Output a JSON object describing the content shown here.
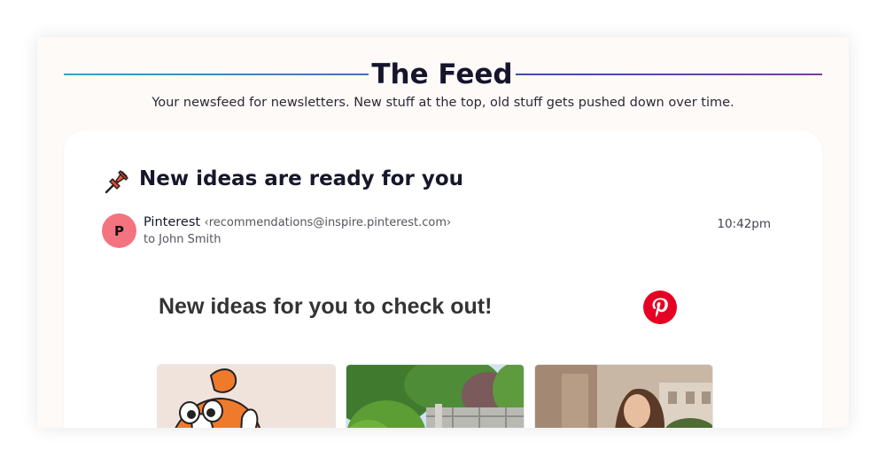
{
  "feed": {
    "title": "The Feed",
    "subtitle": "Your newsfeed for newsletters. New stuff at the top, old stuff gets pushed down over time."
  },
  "email": {
    "subject": "New ideas are ready for you",
    "subject_icon": "pushpin-icon",
    "sender": {
      "avatar_letter": "P",
      "avatar_color": "#f47380",
      "name": "Pinterest",
      "email": "‹recommendations@inspire.pinterest.com›",
      "recipient": "to John Smith"
    },
    "time": "10:42pm",
    "body": {
      "heading": "New ideas for you to check out!",
      "logo": "pinterest-logo",
      "brand_color": "#e60023",
      "thumbnails": [
        "clownfish-drawing-thumbnail",
        "garden-fence-thumbnail",
        "woman-portrait-thumbnail"
      ]
    }
  }
}
